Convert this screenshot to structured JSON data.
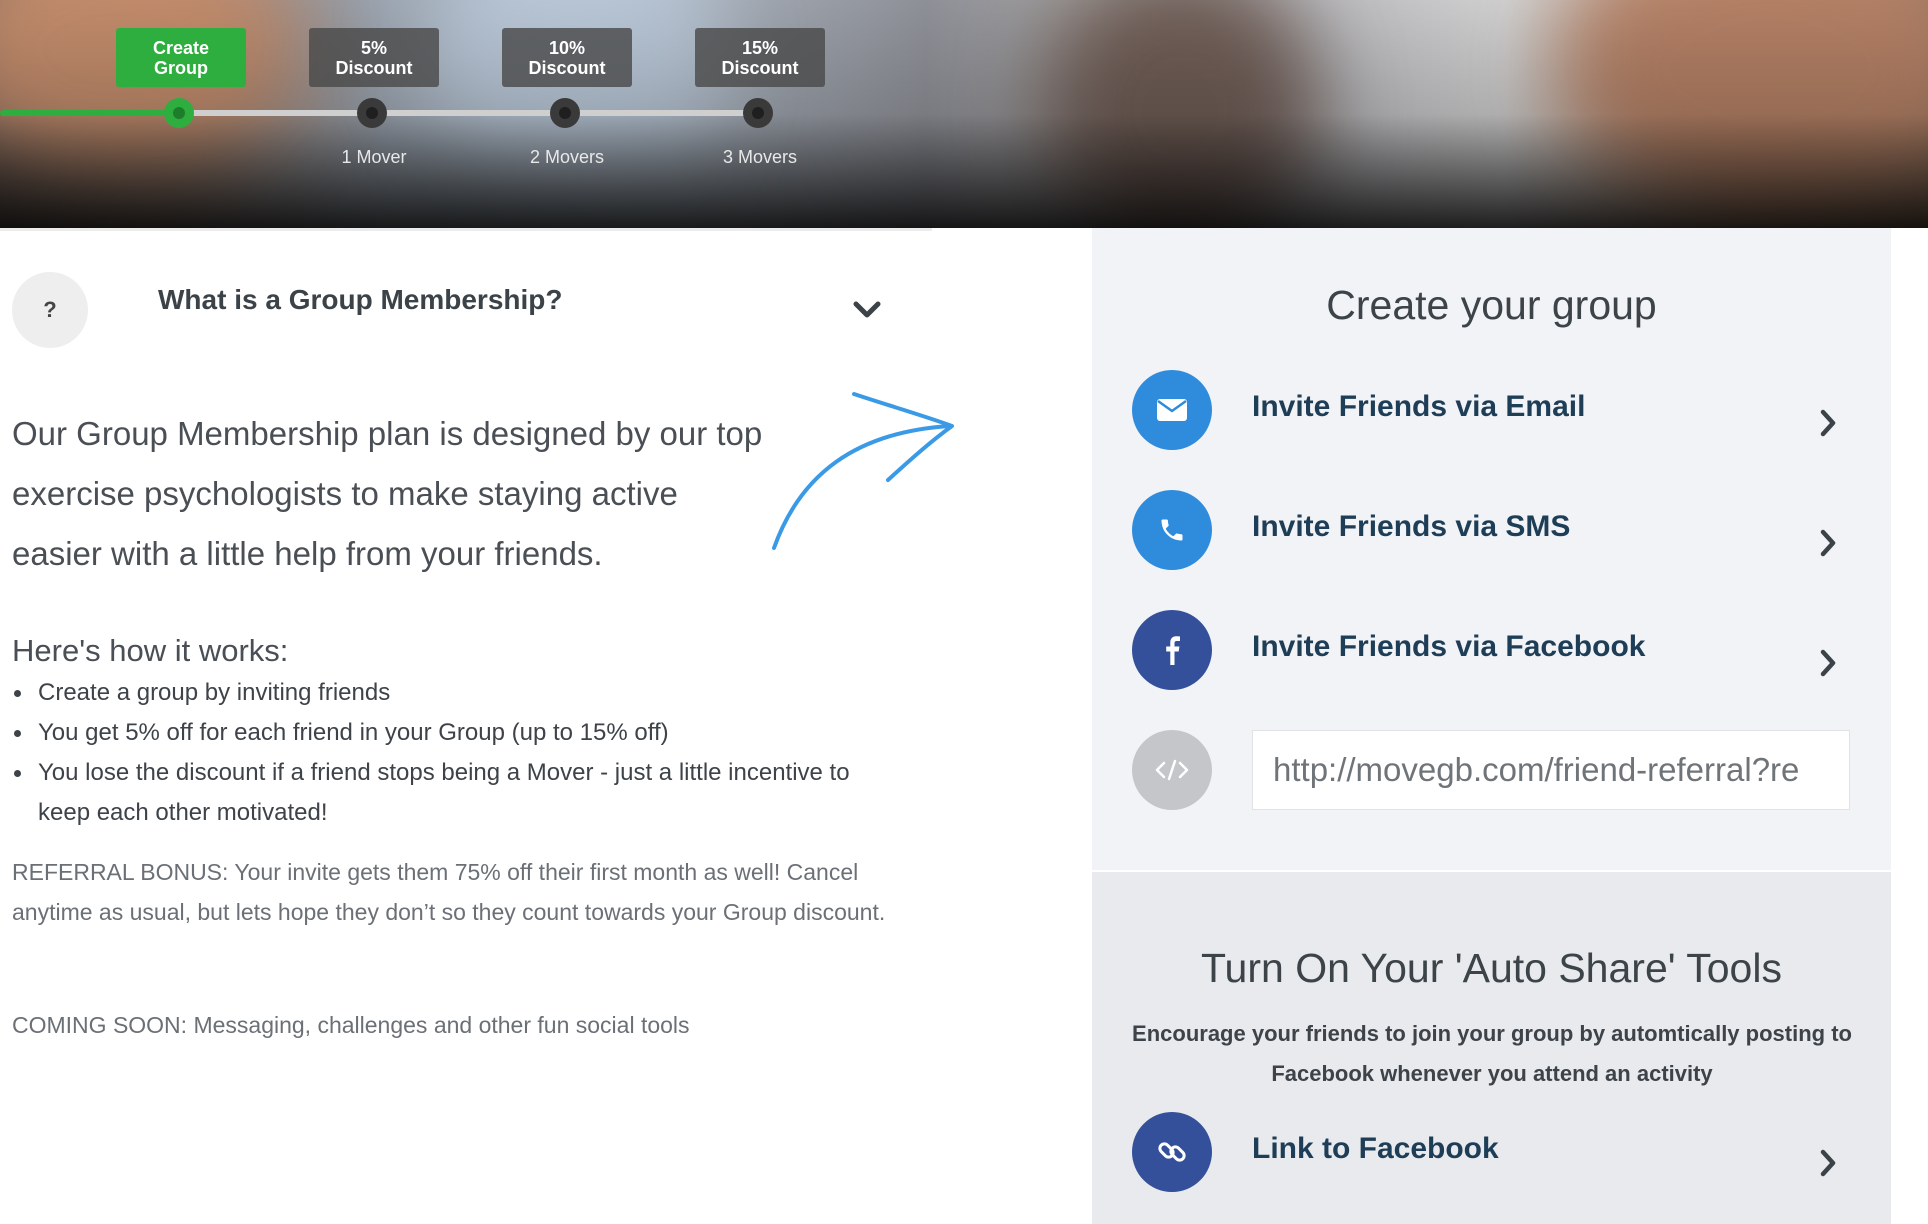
{
  "steps": [
    {
      "tag": "Create\nGroup",
      "mover": ""
    },
    {
      "tag": "5%\nDiscount",
      "mover": "1 Mover"
    },
    {
      "tag": "10%\nDiscount",
      "mover": "2 Movers"
    },
    {
      "tag": "15%\nDiscount",
      "mover": "3 Movers"
    }
  ],
  "progress": {
    "completed_steps": 1,
    "total_steps": 4
  },
  "faq": {
    "icon_text": "?",
    "title": "What is a Group Membership?"
  },
  "intro": "Our Group Membership plan is designed by our top exercise psychologists to make staying active easier with a little help from your friends.",
  "how": {
    "title": "Here's how it works:",
    "items": [
      "Create a group by inviting friends",
      "You get 5% off for each friend in your Group (up to 15% off)",
      "You lose the discount if a friend stops being a Mover - just a little incentive to keep each other motivated!"
    ]
  },
  "referral": "REFERRAL BONUS: Your invite gets them 75% off their first month as well! Cancel anytime as usual, but lets hope they don’t so they count towards your Group discount.",
  "coming_soon": "COMING SOON: Messaging, challenges and other fun social tools",
  "create_group": {
    "title": "Create your group",
    "invite_email": "Invite Friends via Email",
    "invite_sms": "Invite Friends via SMS",
    "invite_facebook": "Invite Friends via Facebook",
    "referral_url": "http://movegb.com/friend-referral?re"
  },
  "auto_share": {
    "title": "Turn On Your 'Auto Share' Tools",
    "description": "Encourage your friends to join your group by automtically posting to Facebook whenever you attend an activity",
    "link_facebook": "Link to Facebook"
  },
  "colors": {
    "accent_green": "#2dae3e",
    "email_blue": "#2f8bdc",
    "sms_blue": "#2f8bdc",
    "facebook_navy": "#34509b",
    "embed_gray": "#c4c6c9",
    "link_navy": "#34509b",
    "arrow_blue": "#3b9ae6"
  },
  "icons": {
    "email": "envelope-icon",
    "sms": "phone-icon",
    "facebook": "facebook-icon",
    "embed": "code-icon",
    "link": "link-icon"
  }
}
